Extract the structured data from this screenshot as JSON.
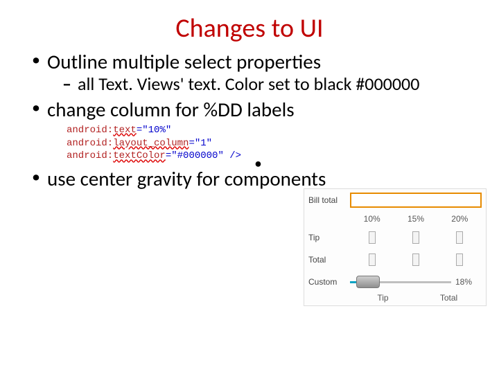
{
  "title": "Changes to UI",
  "bullets": {
    "b1": "Outline multiple select properties",
    "b1_sub": "all Text. Views' text. Color set to black #000000",
    "b2": "change column for %DD labels",
    "b3": "use center gravity for components"
  },
  "code": {
    "l1_attr": "android:",
    "l1_word1": "text",
    "l1_eq": "=",
    "l1_val": "\"10%\"",
    "l2_attr": "android:",
    "l2_word1": "layout_column",
    "l2_eq": "=",
    "l2_val": "\"1\"",
    "l3_attr": "android:",
    "l3_word1": "textColor",
    "l3_eq": "=",
    "l3_val": "\"#000000\"",
    "l3_close": " />",
    "stray_bullet": "•"
  },
  "phone": {
    "bill_label": "Bill total",
    "pct10": "10%",
    "pct15": "15%",
    "pct20": "20%",
    "tip_label": "Tip",
    "total_label": "Total",
    "custom_label": "Custom",
    "seek_value": "18%",
    "foot_tip": "Tip",
    "foot_total": "Total"
  }
}
